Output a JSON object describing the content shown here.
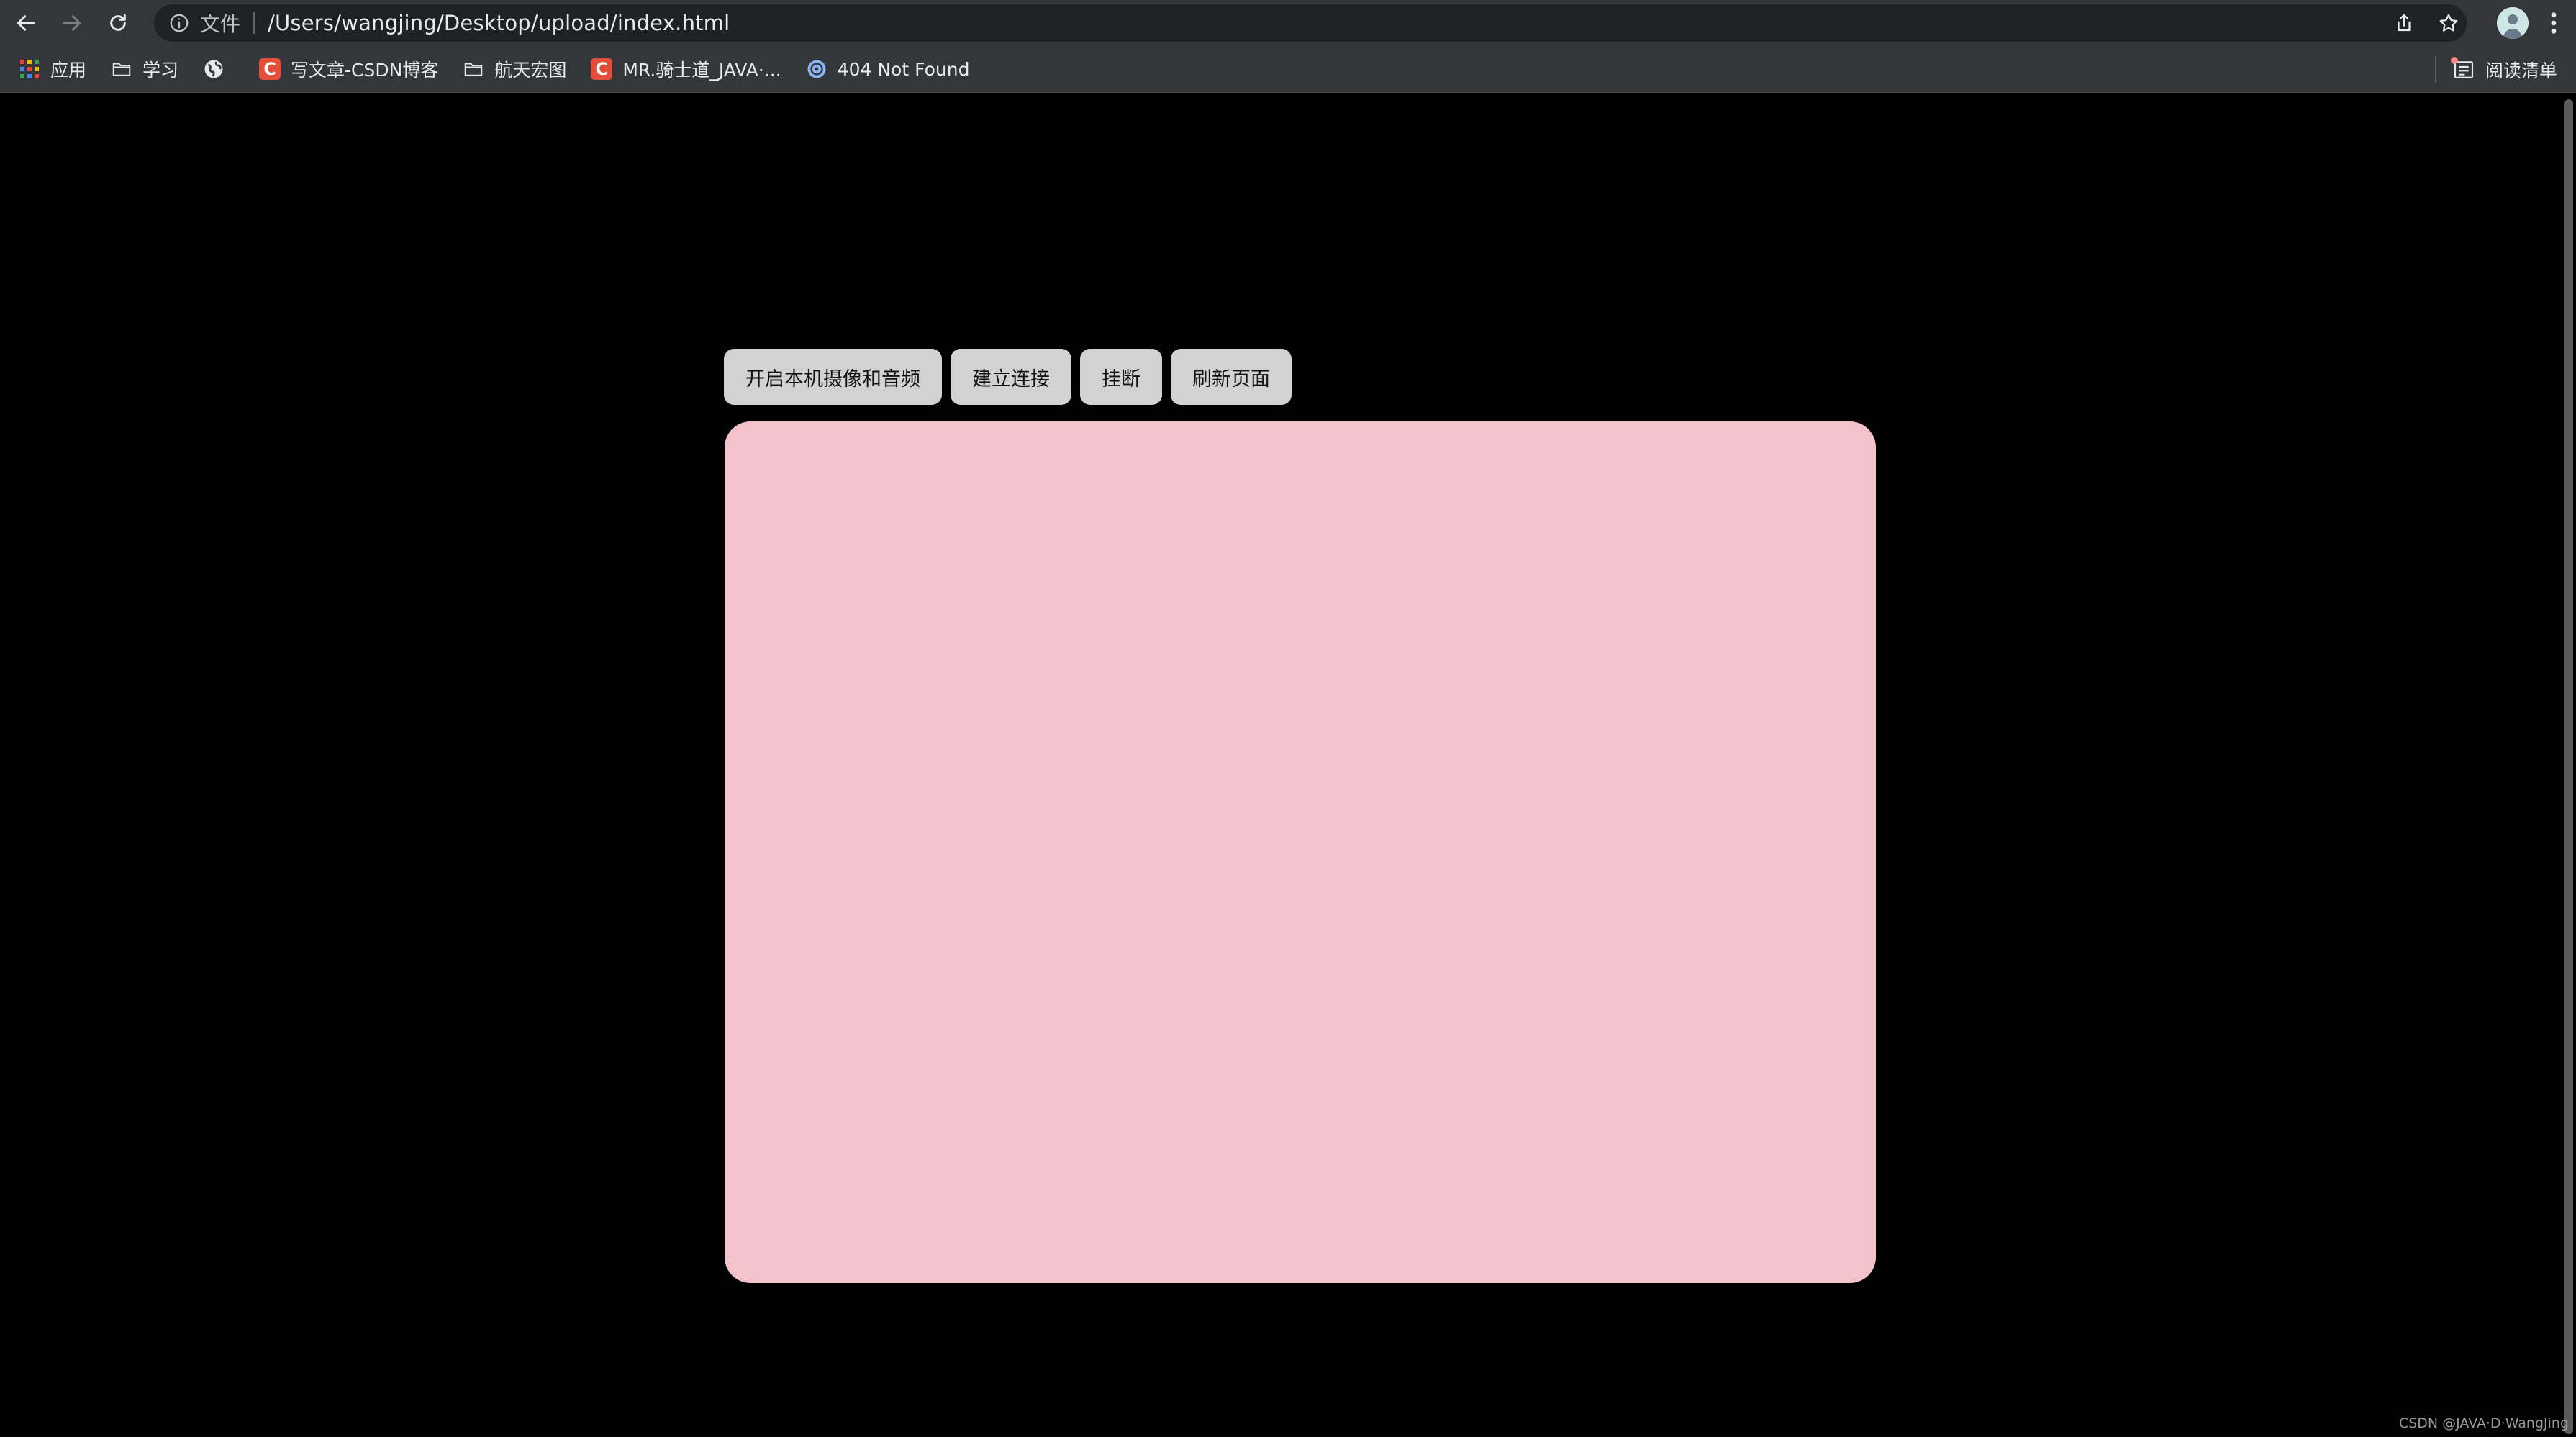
{
  "browser": {
    "url_scheme_label": "文件",
    "url": "/Users/wangjing/Desktop/upload/index.html",
    "bookmarks": [
      {
        "label": "应用",
        "icon": "apps-grid-icon"
      },
      {
        "label": "学习",
        "icon": "folder-icon"
      },
      {
        "label": "",
        "icon": "globe-icon"
      },
      {
        "label": "写文章-CSDN博客",
        "icon": "csdn-icon"
      },
      {
        "label": "航天宏图",
        "icon": "folder-icon"
      },
      {
        "label": "MR.骑士道_JAVA·...",
        "icon": "csdn-icon"
      },
      {
        "label": "404 Not Found",
        "icon": "gear-badge-icon"
      }
    ],
    "reading_list_label": "阅读清单",
    "csdn_letter": "C"
  },
  "page": {
    "buttons": {
      "open_camera": "开启本机摄像和音频",
      "connect": "建立连接",
      "hangup": "挂断",
      "refresh": "刷新页面"
    },
    "video_box_color": "#f4c2ca",
    "background_color": "#000000"
  },
  "watermark": "CSDN @JAVA·D·WangJing"
}
